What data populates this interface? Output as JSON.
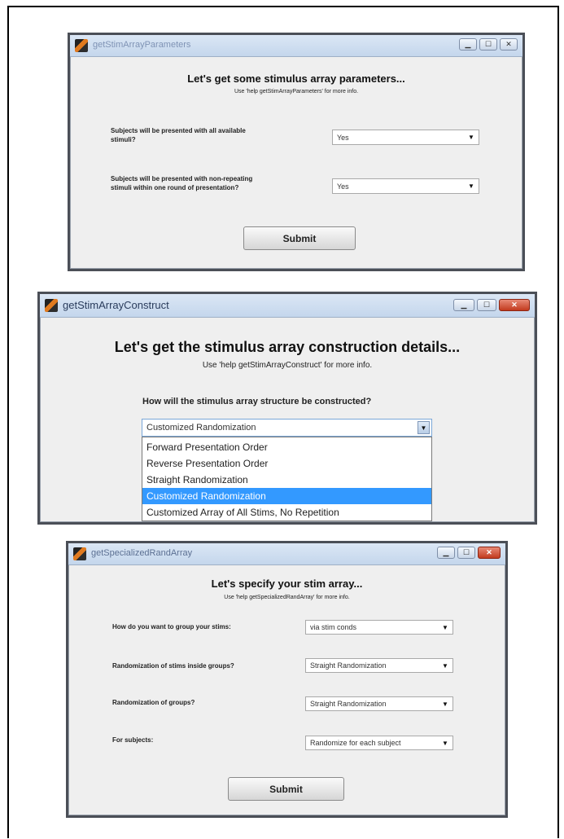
{
  "window1": {
    "title": "getStimArrayParameters",
    "heading": "Let's get some stimulus array parameters...",
    "hint": "Use 'help getStimArrayParameters' for more info.",
    "q1_line1": "Subjects will be presented with all available",
    "q1_line2": "stimuli?",
    "q1_value": "Yes",
    "q2_line1": "Subjects will be presented with non-repeating",
    "q2_line2": "stimuli within one round of presentation?",
    "q2_value": "Yes",
    "submit": "Submit"
  },
  "window2": {
    "title": "getStimArrayConstruct",
    "heading": "Let's get the stimulus array construction details...",
    "hint": "Use 'help getStimArrayConstruct' for more info.",
    "question": "How will the stimulus array structure be constructed?",
    "selected": "Customized Randomization",
    "options": [
      "Forward Presentation Order",
      "Reverse Presentation Order",
      "Straight Randomization",
      "Customized Randomization",
      "Customized Array of All Stims, No Repetition"
    ]
  },
  "window3": {
    "title": "getSpecializedRandArray",
    "heading": "Let's specify your stim array...",
    "hint": "Use 'help getSpecializedRandArray' for more info.",
    "q1": "How do you want to group your stims:",
    "q1_value": "via stim conds",
    "q2": "Randomization of stims inside groups?",
    "q2_value": "Straight Randomization",
    "q3": "Randomization of groups?",
    "q3_value": "Straight Randomization",
    "q4": "For subjects:",
    "q4_value": "Randomize for each subject",
    "submit": "Submit"
  }
}
